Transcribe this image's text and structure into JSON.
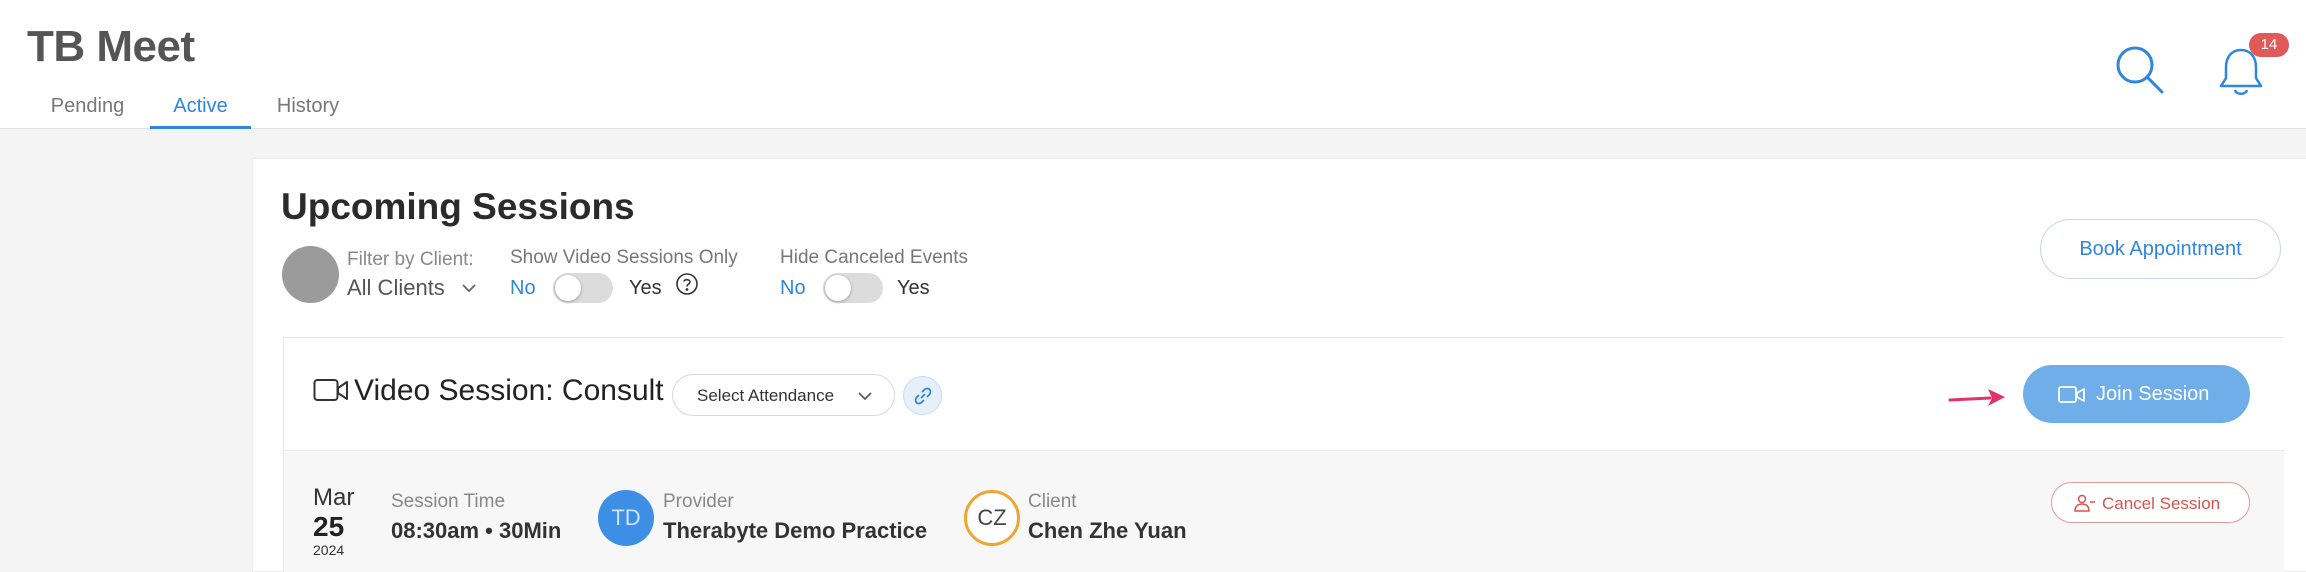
{
  "app": {
    "title": "TB Meet"
  },
  "tabs": [
    {
      "label": "Pending"
    },
    {
      "label": "Active"
    },
    {
      "label": "History"
    }
  ],
  "header": {
    "notification_count": "14",
    "search_icon": "search-icon",
    "bell_icon": "bell-icon"
  },
  "page": {
    "title": "Upcoming Sessions"
  },
  "filters": {
    "client_label": "Filter by Client:",
    "client_value": "All Clients",
    "video_only": {
      "label": "Show Video Sessions Only",
      "no": "No",
      "yes": "Yes",
      "enabled": false
    },
    "hide_canceled": {
      "label": "Hide Canceled Events",
      "no": "No",
      "yes": "Yes",
      "enabled": false
    }
  },
  "actions": {
    "book": "Book Appointment"
  },
  "session": {
    "title": "Video Session: Consult",
    "attendance_placeholder": "Select Attendance",
    "join": "Join Session",
    "cancel": "Cancel Session",
    "date": {
      "month": "Mar",
      "day": "25",
      "year": "2024"
    },
    "time_label": "Session Time",
    "time_value": "08:30am • 30Min",
    "provider_label": "Provider",
    "provider_initials": "TD",
    "provider_name": "Therabyte Demo Practice",
    "client_label": "Client",
    "client_initials": "CZ",
    "client_name": "Chen Zhe Yuan"
  },
  "colors": {
    "accent": "#2e86de",
    "join_bg": "#6faee9",
    "badge": "#e05a5a",
    "cancel": "#d9534f",
    "arrow": "#e0336b"
  }
}
